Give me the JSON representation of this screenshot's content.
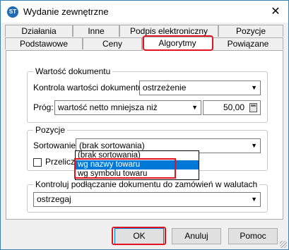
{
  "window": {
    "title": "Wydanie zewnętrzne",
    "app_icon": "ST",
    "close_icon": "✕"
  },
  "tabs_row1": [
    "Działania",
    "Inne",
    "Podpis elektroniczny",
    "Pozycje"
  ],
  "tabs_row2": [
    "Podstawowe",
    "Ceny",
    "Algorytmy",
    "Powiązane"
  ],
  "active_tab": "Algorytmy",
  "wartosc": {
    "group_title": "Wartość dokumentu",
    "kontrola_label": "Kontrola wartości dokumentu:",
    "kontrola_value": "ostrzeżenie",
    "prog_label": "Próg:",
    "prog_value": "wartość netto mniejsza niż",
    "prog_amount": "50,00"
  },
  "pozycje": {
    "group_title": "Pozycje",
    "sortowanie_label": "Sortowanie:",
    "sortowanie_value": "(brak sortowania)",
    "przeliczaj_label": "Przeliczaj pozy",
    "options": [
      "(brak sortowania)",
      "wg nazwy towaru",
      "wg symbolu towaru"
    ],
    "selected_option": "wg nazwy towaru"
  },
  "zamowienia": {
    "group_title": "Kontroluj podłączanie dokumentu do zamówień w walutach",
    "value": "ostrzegaj"
  },
  "buttons": {
    "ok": "OK",
    "cancel": "Anuluj",
    "help": "Pomoc"
  },
  "colors": {
    "highlight": "#e0141e",
    "selection": "#0078d7",
    "border": "#3c7fb1"
  }
}
